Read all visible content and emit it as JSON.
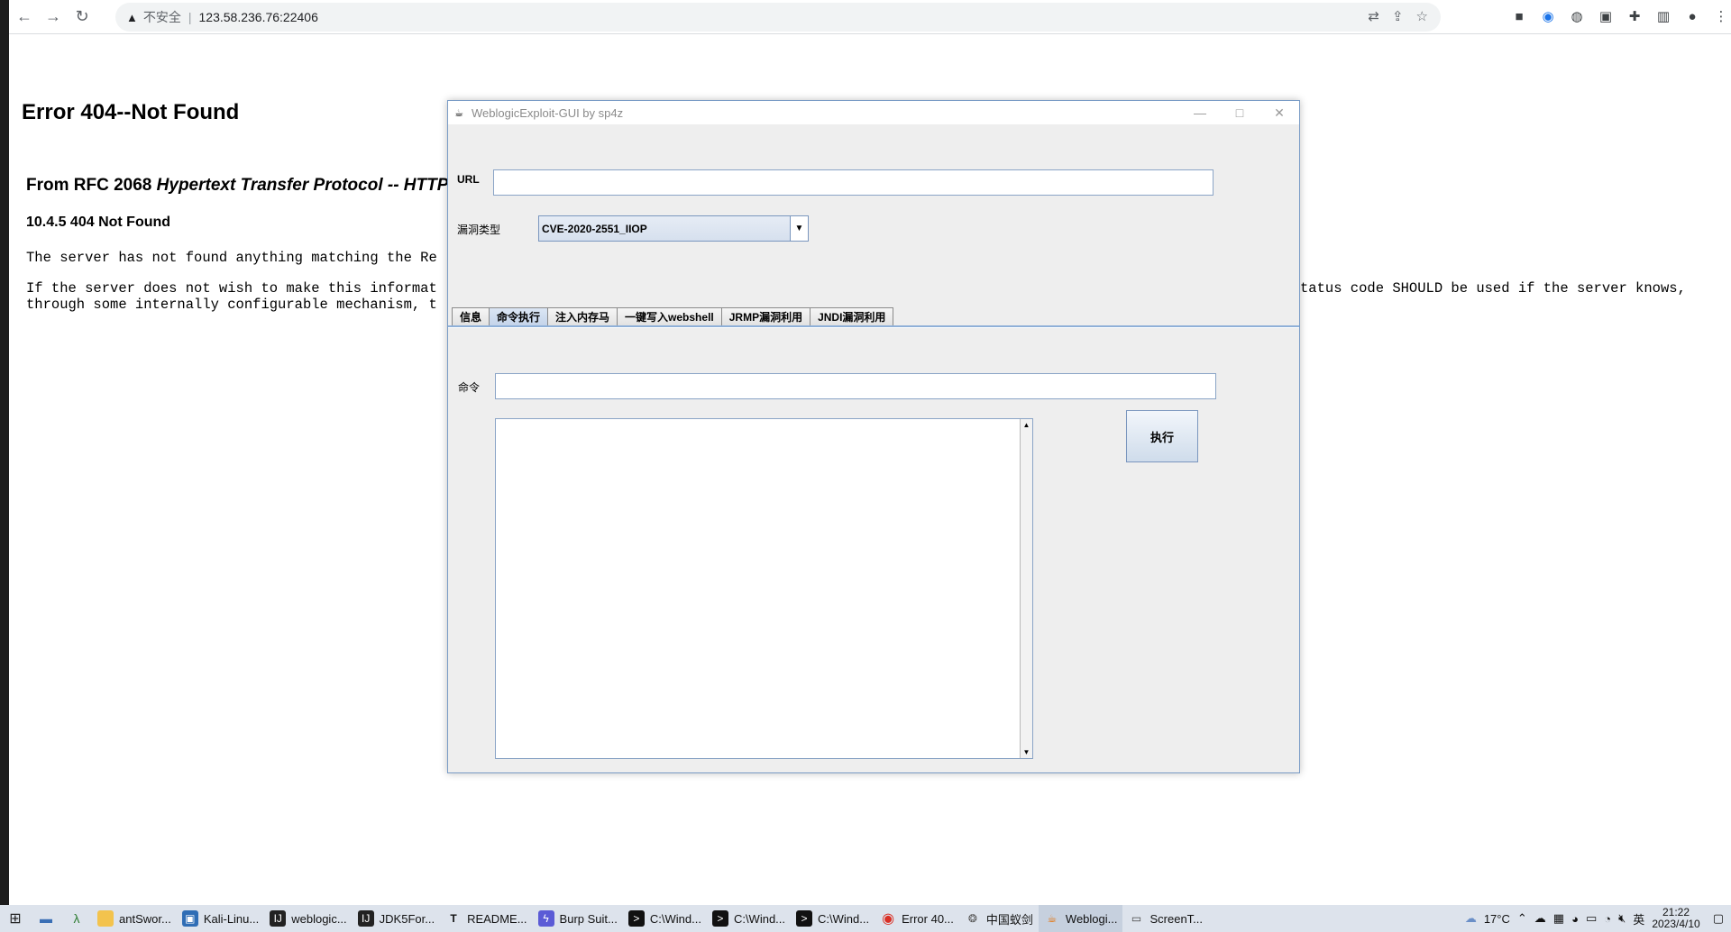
{
  "browser": {
    "security_label": "不安全",
    "url": "123.58.236.76:22406"
  },
  "page": {
    "title": "Error 404--Not Found",
    "rfc_prefix": "From RFC 2068 ",
    "rfc_italic": "Hypertext Transfer Protocol -- HTTP/",
    "status": "10.4.5 404 Not Found",
    "line1": "The server has not found anything matching the Re",
    "line2a": "If the server does not wish to make this informat",
    "line2b": "through some internally configurable mechanism, t",
    "line2c": "tatus code SHOULD be used if the server knows,"
  },
  "app": {
    "title": "WeblogicExploit-GUI by sp4z",
    "url_label": "URL",
    "url_value": "",
    "vuln_label": "漏洞类型",
    "vuln_value": "CVE-2020-2551_IIOP",
    "tabs": [
      {
        "label": "信息"
      },
      {
        "label": "命令执行"
      },
      {
        "label": "注入内存马"
      },
      {
        "label": "一键写入webshell"
      },
      {
        "label": "JRMP漏洞利用"
      },
      {
        "label": "JNDI漏洞利用"
      }
    ],
    "cmd_label": "命令",
    "cmd_value": "",
    "output": "",
    "exec_label": "执行"
  },
  "taskbar": {
    "items": [
      {
        "label": "antSwor...",
        "icon": "folder-icon"
      },
      {
        "label": "Kali-Linu...",
        "icon": "vm-icon"
      },
      {
        "label": "weblogic...",
        "icon": "idea-icon"
      },
      {
        "label": "JDK5For...",
        "icon": "idea-icon"
      },
      {
        "label": "README...",
        "icon": "typora-icon"
      },
      {
        "label": "Burp Suit...",
        "icon": "burp-icon"
      },
      {
        "label": "C:\\Wind...",
        "icon": "cmd-icon"
      },
      {
        "label": "C:\\Wind...",
        "icon": "cmd-icon"
      },
      {
        "label": "C:\\Wind...",
        "icon": "cmd-icon"
      },
      {
        "label": "Error 40...",
        "icon": "chrome-icon"
      },
      {
        "label": "中国蚁剑",
        "icon": "antsword-icon"
      },
      {
        "label": "Weblogi...",
        "icon": "java-icon"
      },
      {
        "label": "ScreenT...",
        "icon": "screen-icon"
      }
    ],
    "weather": "17°C",
    "ime": "英",
    "time": "21:22",
    "date": "2023/4/10"
  }
}
